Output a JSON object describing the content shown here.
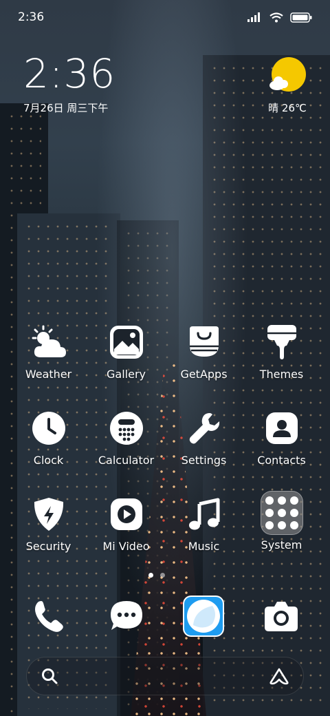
{
  "status_bar": {
    "time": "2:36"
  },
  "clock_widget": {
    "time": "2:36",
    "date": "7月26日 周三下午"
  },
  "weather_widget": {
    "text": "晴 26℃",
    "icon": "sun-with-cloud-icon"
  },
  "apps": [
    {
      "label": "Weather",
      "icon": "weather-icon"
    },
    {
      "label": "Gallery",
      "icon": "gallery-icon"
    },
    {
      "label": "GetApps",
      "icon": "getapps-icon"
    },
    {
      "label": "Themes",
      "icon": "themes-icon"
    },
    {
      "label": "Clock",
      "icon": "clock-icon"
    },
    {
      "label": "Calculator",
      "icon": "calculator-icon"
    },
    {
      "label": "Settings",
      "icon": "settings-icon"
    },
    {
      "label": "Contacts",
      "icon": "contacts-icon"
    },
    {
      "label": "Security",
      "icon": "security-icon"
    },
    {
      "label": "Mi Video",
      "icon": "mi-video-icon"
    },
    {
      "label": "Music",
      "icon": "music-icon"
    },
    {
      "label": "System",
      "icon": "system-folder-icon"
    }
  ],
  "page_indicator": {
    "pages": 2,
    "active": 0
  },
  "dock": [
    {
      "icon": "phone-icon"
    },
    {
      "icon": "messages-icon"
    },
    {
      "icon": "browser-icon"
    },
    {
      "icon": "camera-icon"
    }
  ],
  "search_bar": {
    "left_icon": "search-icon",
    "right_icon": "assistant-icon"
  },
  "colors": {
    "sun": "#f5c800",
    "browser_blue": "#1e9cf0",
    "icon_white": "#ffffff"
  }
}
